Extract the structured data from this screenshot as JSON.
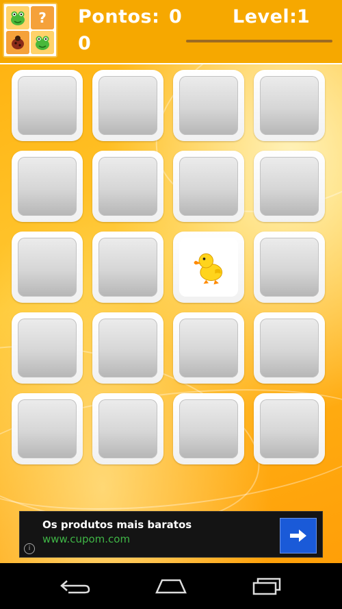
{
  "header": {
    "score_label": "Pontos:",
    "score_value": "0",
    "score_overflow": "0",
    "level_label": "Level:",
    "level_value": "1",
    "progress": 0,
    "icon": "memory-game-app-icon"
  },
  "board": {
    "rows": 5,
    "cols": 4,
    "revealed": [
      {
        "row": 3,
        "col": 3,
        "content": "duckling-icon"
      }
    ]
  },
  "ad": {
    "title": "Os produtos mais baratos",
    "url": "www.cupom.com",
    "info_icon": "info-icon",
    "cta_icon": "arrow-right-icon"
  },
  "navbar": {
    "buttons": [
      "back-icon",
      "home-icon",
      "recent-apps-icon"
    ]
  },
  "colors": {
    "header": "#f6a800",
    "board": "#ffb412",
    "ad_url": "#3fb546",
    "ad_cta": "#1a5ad8"
  }
}
